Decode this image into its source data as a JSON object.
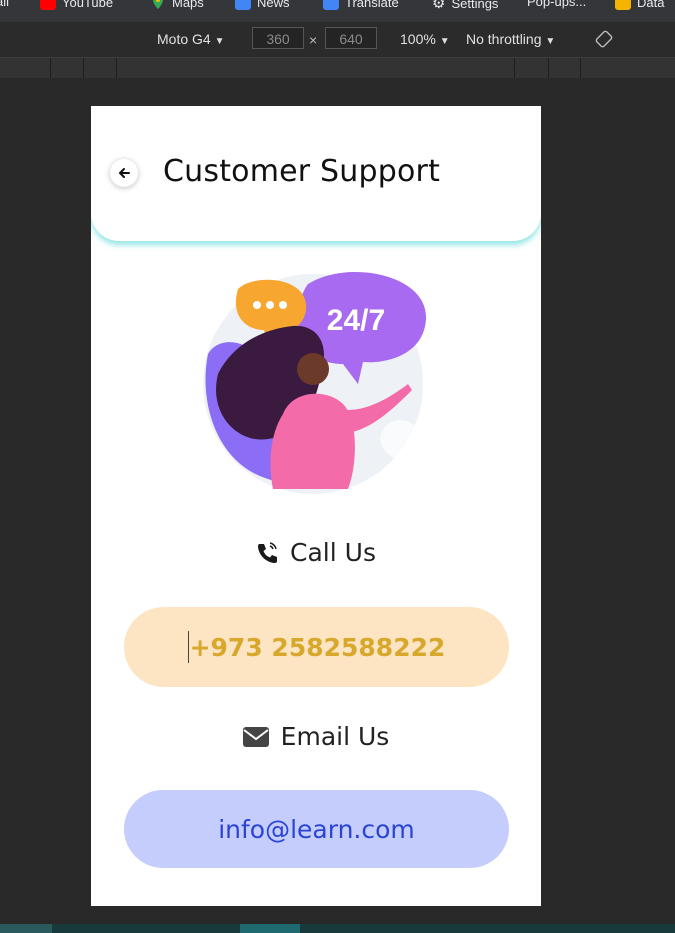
{
  "browser": {
    "bookmarks": [
      {
        "label": "ail",
        "icon": "none"
      },
      {
        "label": "YouTube",
        "icon": "youtube-icon",
        "color": "#ff0000"
      },
      {
        "label": "Maps",
        "icon": "maps-icon",
        "color": "#34a853"
      },
      {
        "label": "News",
        "icon": "news-icon",
        "color": "#4285f4"
      },
      {
        "label": "Translate",
        "icon": "translate-icon",
        "color": "#4285f4"
      },
      {
        "label": "Settings",
        "icon": "gear-icon",
        "color": "#ffffff"
      },
      {
        "label": "Pop-ups...",
        "icon": "none"
      },
      {
        "label": "Data",
        "icon": "data-icon",
        "color": "#f4b400"
      }
    ]
  },
  "devtools": {
    "device": "Moto G4",
    "width": "360",
    "times": "×",
    "height": "640",
    "zoom": "100%",
    "throttling": "No throttling"
  },
  "app": {
    "title": "Customer Support",
    "call_label": "Call Us",
    "phone_number": "+973 2582588222",
    "email_label": "Email Us",
    "email_address": "info@learn.com",
    "illustration_text": "24/7",
    "colors": {
      "header_shadow": "#40d2d2",
      "phone_pill_bg": "#fde4c3",
      "phone_text": "#d7a82c",
      "email_pill_bg": "#c5cdfd",
      "email_text": "#2a44d4"
    }
  }
}
